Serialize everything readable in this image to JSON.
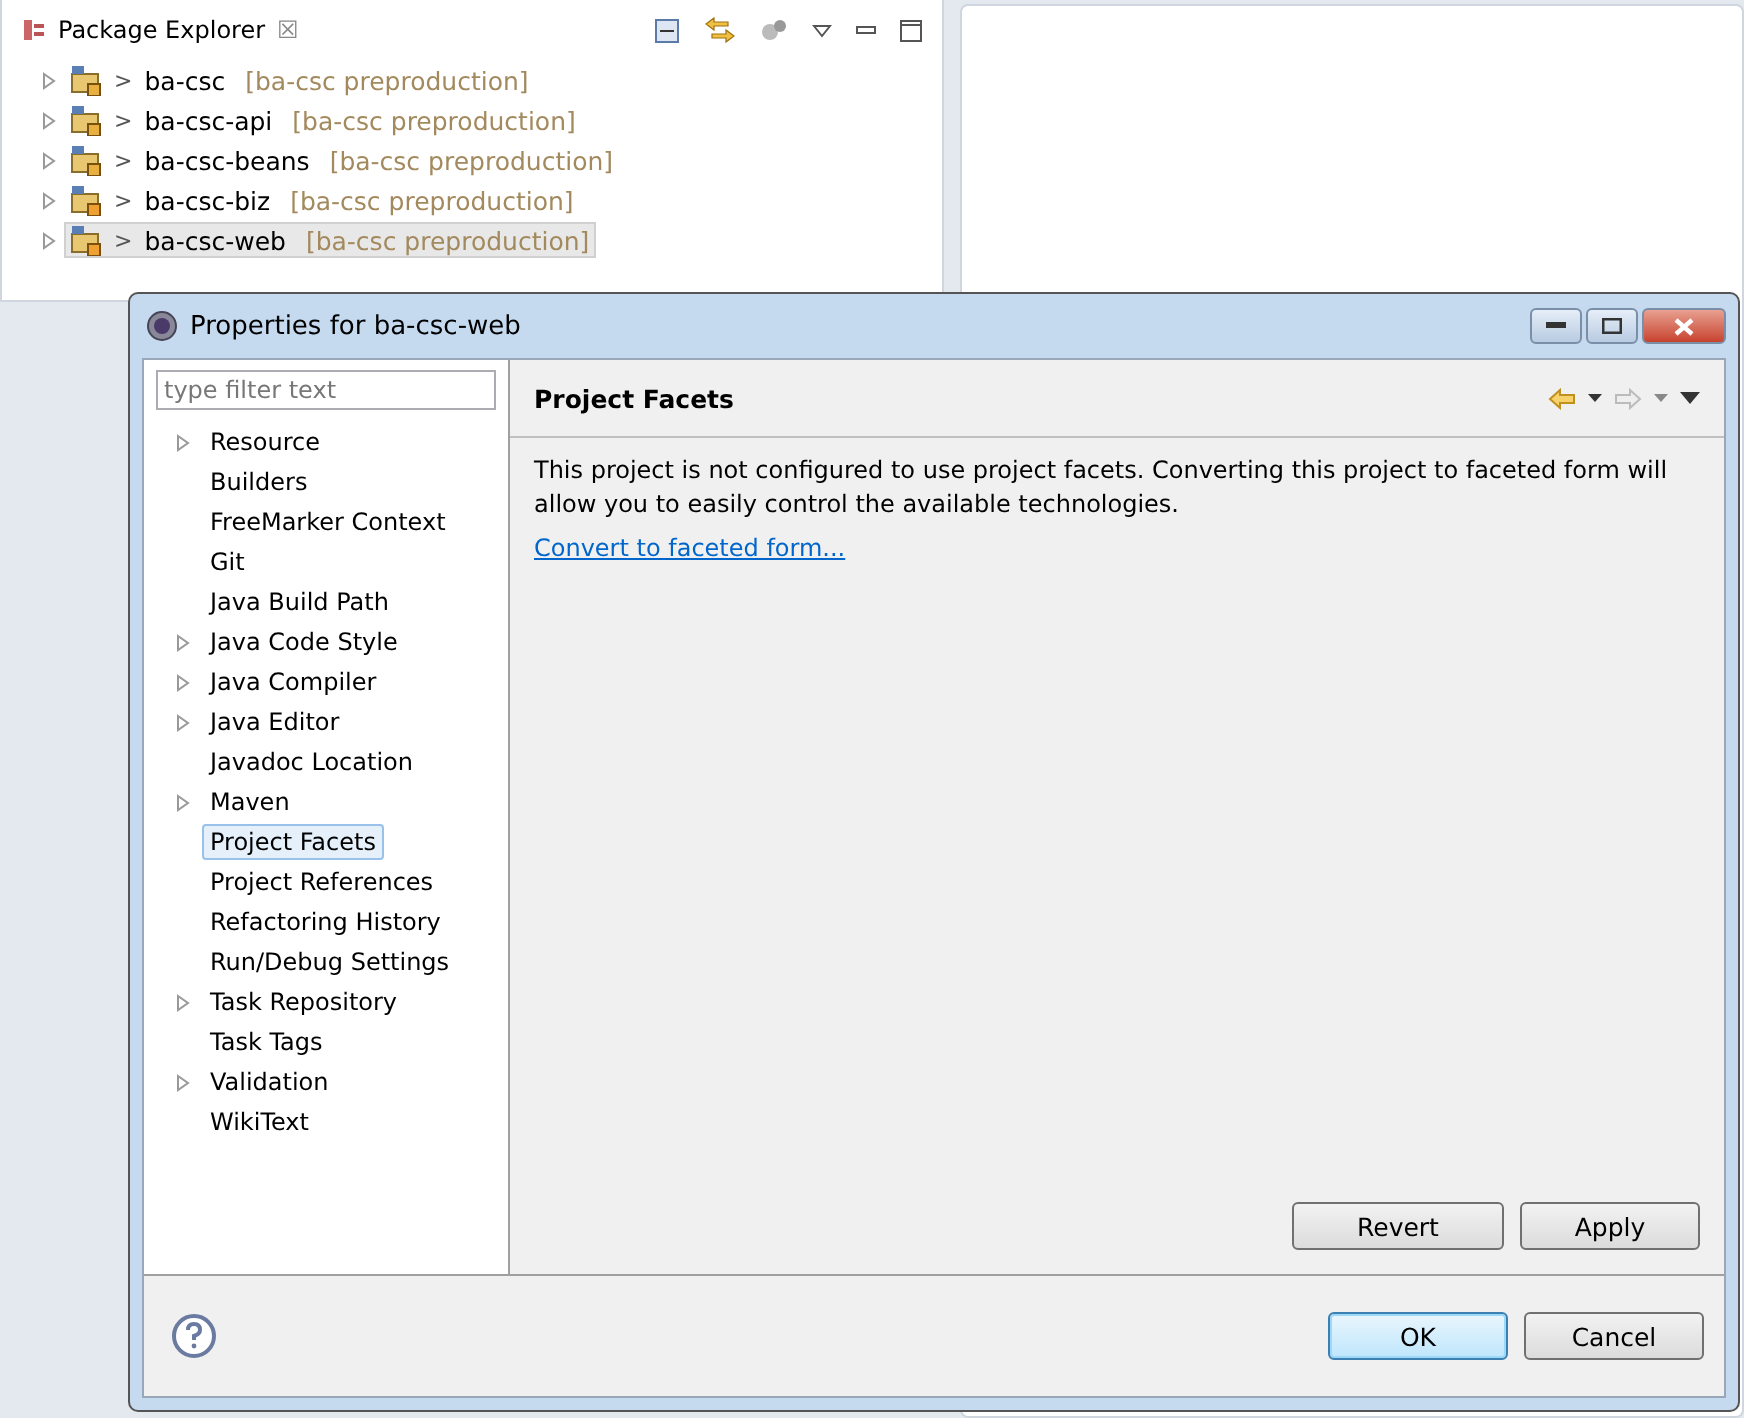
{
  "view": {
    "title": "Package Explorer",
    "close": "☒"
  },
  "projects": [
    {
      "prefix": ">",
      "name": "ba-csc",
      "tag": "[ba-csc preproduction]",
      "selected": false
    },
    {
      "prefix": ">",
      "name": "ba-csc-api",
      "tag": "[ba-csc preproduction]",
      "selected": false
    },
    {
      "prefix": ">",
      "name": "ba-csc-beans",
      "tag": "[ba-csc preproduction]",
      "selected": false
    },
    {
      "prefix": ">",
      "name": "ba-csc-biz",
      "tag": "[ba-csc preproduction]",
      "selected": false
    },
    {
      "prefix": ">",
      "name": "ba-csc-web",
      "tag": "[ba-csc preproduction]",
      "selected": true
    }
  ],
  "dialog": {
    "title": "Properties for ba-csc-web",
    "filter": {
      "placeholder": "type filter text"
    },
    "nav": [
      {
        "label": "Resource",
        "expandable": true,
        "selected": false
      },
      {
        "label": "Builders",
        "expandable": false,
        "selected": false
      },
      {
        "label": "FreeMarker Context",
        "expandable": false,
        "selected": false
      },
      {
        "label": "Git",
        "expandable": false,
        "selected": false
      },
      {
        "label": "Java Build Path",
        "expandable": false,
        "selected": false
      },
      {
        "label": "Java Code Style",
        "expandable": true,
        "selected": false
      },
      {
        "label": "Java Compiler",
        "expandable": true,
        "selected": false
      },
      {
        "label": "Java Editor",
        "expandable": true,
        "selected": false
      },
      {
        "label": "Javadoc Location",
        "expandable": false,
        "selected": false
      },
      {
        "label": "Maven",
        "expandable": true,
        "selected": false
      },
      {
        "label": "Project Facets",
        "expandable": false,
        "selected": true
      },
      {
        "label": "Project References",
        "expandable": false,
        "selected": false
      },
      {
        "label": "Refactoring History",
        "expandable": false,
        "selected": false
      },
      {
        "label": "Run/Debug Settings",
        "expandable": false,
        "selected": false
      },
      {
        "label": "Task Repository",
        "expandable": true,
        "selected": false
      },
      {
        "label": "Task Tags",
        "expandable": false,
        "selected": false
      },
      {
        "label": "Validation",
        "expandable": true,
        "selected": false
      },
      {
        "label": "WikiText",
        "expandable": false,
        "selected": false
      }
    ],
    "page": {
      "title": "Project Facets",
      "message": "This project is not configured to use project facets. Converting this project to faceted form will allow you to easily control the available technologies.",
      "link": "Convert to faceted form..."
    },
    "page_buttons": [
      "Revert",
      "Apply"
    ],
    "buttons": [
      {
        "label": "OK",
        "default": true
      },
      {
        "label": "Cancel",
        "default": false
      }
    ]
  }
}
